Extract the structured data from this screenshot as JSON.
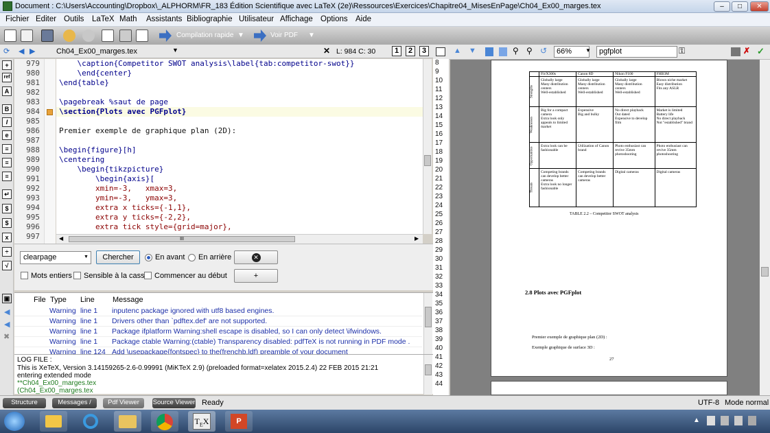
{
  "window": {
    "title": "Document : C:\\Users\\Accounting\\Dropbox\\_ALPHORM\\FR_183 Édition Scientifique avec LaTeX (2e)\\Ressources\\Exercices\\Chapitre04_MisesEnPage\\Ch04_Ex00_marges.tex"
  },
  "menu": [
    "Fichier",
    "Editer",
    "Outils",
    "LaTeX",
    "Math",
    "Assistants",
    "Bibliographie",
    "Utilisateur",
    "Affichage",
    "Options",
    "Aide"
  ],
  "toolbar": {
    "compile_label": "Compilation rapide",
    "view_label": "Voir PDF"
  },
  "editor": {
    "tab_name": "Ch04_Ex00_marges.tex",
    "position": "L: 984 C: 30",
    "view_buttons": [
      "1",
      "2",
      "3"
    ],
    "line_numbers": [
      "979",
      "980",
      "981",
      "982",
      "983",
      "984",
      "985",
      "986",
      "987",
      "988",
      "989",
      "990",
      "991",
      "992",
      "993",
      "994",
      "995",
      "996",
      "997"
    ],
    "lines": [
      "    \\caption{Competitor SWOT analysis\\label{tab:competitor-swot}}",
      "    \\end{center}",
      "\\end{table}",
      "",
      "\\pagebreak %saut de page",
      "\\section{Plots avec PGFplot}",
      "",
      "Premier exemple de graphique plan (2D):",
      "",
      "\\begin{figure}[h]",
      "\\centering",
      "    \\begin{tikzpicture}",
      "        \\begin{axis}[",
      "        xmin=-3,   xmax=3,",
      "        ymin=-3,   ymax=3,",
      "        extra x ticks={-1,1},",
      "        extra y ticks={-2,2},",
      "        extra tick style={grid=major},",
      ""
    ],
    "hscroll_grip": "III"
  },
  "find": {
    "search_value": "clearpage",
    "find_button": "Chercher",
    "forward_label": "En avant",
    "backward_label": "En arrière",
    "whole_words": "Mots entiers",
    "case_sensitive": "Sensible à la casse",
    "from_start": "Commencer au début",
    "plus": "+"
  },
  "messages": {
    "headers": [
      "File",
      "Type",
      "Line",
      "Message"
    ],
    "rows": [
      {
        "type": "Warning",
        "line": "line 1",
        "msg": "inputenc package ignored with utf8 based engines."
      },
      {
        "type": "Warning",
        "line": "line 1",
        "msg": "Drivers other than `pdftex.def' are not supported."
      },
      {
        "type": "Warning",
        "line": "line 1",
        "msg": "Package ifplatform Warning:shell escape is disabled, so I can only detect \\ifwindows."
      },
      {
        "type": "Warning",
        "line": "line 1",
        "msg": "Package ctable Warning:(ctable) Transparency disabled: pdfTeX is not running in PDF mode ."
      },
      {
        "type": "Warning",
        "line": "line 124",
        "msg": "Add \\usepackage{fontspec} to the(frenchb.ldf) preamble of your document"
      }
    ]
  },
  "log": {
    "title": "LOG FILE :",
    "lines": [
      "This is XeTeX, Version 3.14159265-2.6-0.99991 (MiKTeX 2.9) (preloaded format=xelatex 2015.2.4) 22 FEB 2015 21:21",
      "entering extended mode",
      "**Ch04_Ex00_marges.tex",
      "(Ch04_Ex00_marges.tex"
    ]
  },
  "pdf": {
    "zoom": "66%",
    "search_value": "pgfplot",
    "line_numbers": [
      "8",
      "9",
      "10",
      "11",
      "12",
      "13",
      "14",
      "15",
      "16",
      "17",
      "18",
      "19",
      "20",
      "21",
      "22",
      "23",
      "24",
      "25",
      "26",
      "27",
      "28",
      "29",
      "30",
      "31",
      "32",
      "33",
      "34",
      "35",
      "36",
      "37",
      "38",
      "39",
      "40",
      "41",
      "42",
      "43",
      "44"
    ],
    "table_headers": [
      "",
      "Fit/X300s",
      "Canon 8D",
      "Nikon F100",
      "FHB3M"
    ],
    "table_rows": [
      {
        "label": "Strengths",
        "cells": [
          "Globally large\nMany distribution centers\nWell-established",
          "Globally large\nMany distribution centers\nWell-established",
          "Globally large\nMany distribution centers\nWell-established",
          "Blown niche market\nEasy distribution\nFits any ASLR"
        ]
      },
      {
        "label": "Weaknesses",
        "cells": [
          "Big for a compact camera\nExtra look only appeals to limited market",
          "Expensive\nBig and bulky",
          "No direct playback\nOut dated\nExpensive to develop film",
          "Market is limited\nBattery life\nNo direct playback\nNot \"established\" brand"
        ]
      },
      {
        "label": "Opportunities",
        "cells": [
          "Extra look can be fashionable",
          "Utilization of Canon brand",
          "Photo enthusiast can revive 35mm photoshooting",
          "Photo enthusiast can revive 35mm photoshooting"
        ]
      },
      {
        "label": "Threats",
        "cells": [
          "Competing brands can develop better cameras\nExtra look no longer fashionable",
          "Competing brands can develop better cameras",
          "Digital cameras",
          "Digital cameras"
        ]
      }
    ],
    "table_caption": "TABLE 2.2 – Competitor SWOT analysis",
    "section_title": "2.8 Plots avec PGFplot",
    "para1": "Premier exemple de graphique plan (2D) :",
    "para2": "Exemple graphique de surface 3D :",
    "page_number": "27"
  },
  "status": {
    "tabs": [
      "Structure",
      "Messages / Log",
      "Pdf Viewer",
      "Source Viewer"
    ],
    "ready": "Ready",
    "encoding": "UTF-8",
    "mode": "Mode normal"
  },
  "taskbar": {
    "time": "",
    "apps": [
      "start",
      "explorer-folder",
      "ie",
      "folder",
      "chrome",
      "texmaker",
      "powerpoint"
    ]
  },
  "colors": {
    "accent": "#1c2fa8",
    "keyword": "#00008b",
    "value": "#8b0000",
    "highlight": "#ffffe0"
  }
}
